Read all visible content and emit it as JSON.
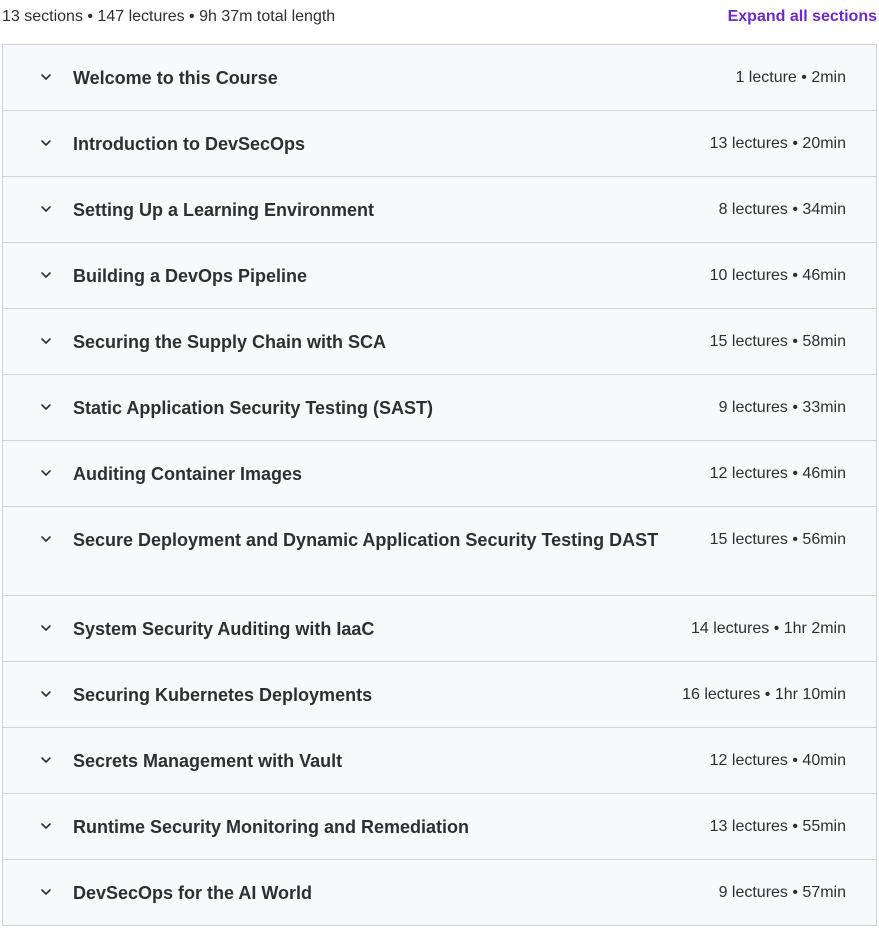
{
  "summary": {
    "text": "13 sections • 147 lectures • 9h 37m total length",
    "expand_label": "Expand all sections"
  },
  "sections": [
    {
      "title": "Welcome to this Course",
      "meta": "1 lecture • 2min"
    },
    {
      "title": "Introduction to DevSecOps",
      "meta": "13 lectures • 20min"
    },
    {
      "title": "Setting Up a Learning Environment",
      "meta": "8 lectures • 34min"
    },
    {
      "title": "Building a DevOps Pipeline",
      "meta": "10 lectures • 46min"
    },
    {
      "title": "Securing the Supply Chain with SCA",
      "meta": "15 lectures • 58min"
    },
    {
      "title": "Static Application Security Testing (SAST)",
      "meta": "9 lectures • 33min"
    },
    {
      "title": "Auditing Container Images",
      "meta": "12 lectures • 46min"
    },
    {
      "title": "Secure Deployment and Dynamic Application Security Testing DAST",
      "meta": "15 lectures • 56min"
    },
    {
      "title": "System Security Auditing with IaaC",
      "meta": "14 lectures • 1hr 2min"
    },
    {
      "title": "Securing Kubernetes Deployments",
      "meta": "16 lectures • 1hr 10min"
    },
    {
      "title": "Secrets Management with Vault",
      "meta": "12 lectures • 40min"
    },
    {
      "title": "Runtime Security Monitoring and Remediation",
      "meta": "13 lectures • 55min"
    },
    {
      "title": "DevSecOps for the AI World",
      "meta": "9 lectures • 57min"
    }
  ],
  "icons": {
    "section_toggle": "chevron-down-icon"
  },
  "colors": {
    "accent": "#6d28d2",
    "text": "#2d2f31",
    "row_background": "#f7f9fa",
    "border": "#d1d2e0"
  }
}
